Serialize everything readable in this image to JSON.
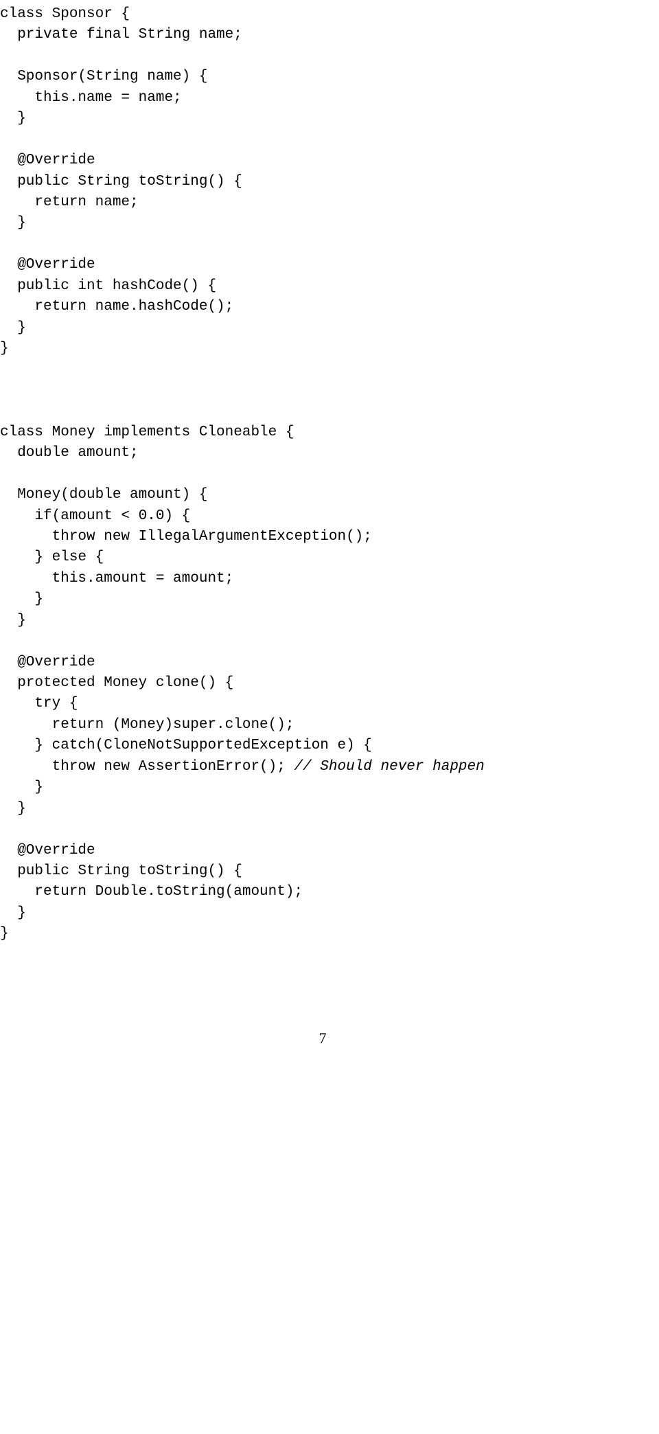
{
  "code": {
    "line1": "class Sponsor {",
    "line2": "  private final String name;",
    "line3": "",
    "line4": "  Sponsor(String name) {",
    "line5": "    this.name = name;",
    "line6": "  }",
    "line7": "",
    "line8": "  @Override",
    "line9": "  public String toString() {",
    "line10": "    return name;",
    "line11": "  }",
    "line12": "",
    "line13": "  @Override",
    "line14": "  public int hashCode() {",
    "line15": "    return name.hashCode();",
    "line16": "  }",
    "line17": "}",
    "line18": "",
    "line19": "",
    "line20": "",
    "line21": "class Money implements Cloneable {",
    "line22": "  double amount;",
    "line23": "",
    "line24": "  Money(double amount) {",
    "line25": "    if(amount < 0.0) {",
    "line26": "      throw new IllegalArgumentException();",
    "line27": "    } else {",
    "line28": "      this.amount = amount;",
    "line29": "    }",
    "line30": "  }",
    "line31": "",
    "line32": "  @Override",
    "line33": "  protected Money clone() {",
    "line34": "    try {",
    "line35": "      return (Money)super.clone();",
    "line36": "    } catch(CloneNotSupportedException e) {",
    "line37_a": "      throw new AssertionError(); ",
    "line37_b": "// Should never happen",
    "line38": "    }",
    "line39": "  }",
    "line40": "",
    "line41": "  @Override",
    "line42": "  public String toString() {",
    "line43": "    return Double.toString(amount);",
    "line44": "  }",
    "line45": "}"
  },
  "pageNumber": "7"
}
